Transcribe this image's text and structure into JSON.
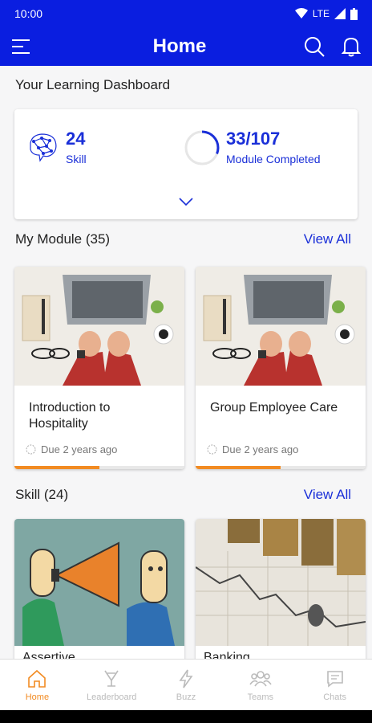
{
  "status": {
    "time": "10:00",
    "network": "LTE"
  },
  "header": {
    "title": "Home"
  },
  "dashboard": {
    "heading": "Your Learning Dashboard",
    "skills_count": "24",
    "skills_label": "Skill",
    "modules_count": "33/107",
    "modules_label": "Module Completed",
    "modules_progress": 0.31
  },
  "modules": {
    "heading": "My Module (35)",
    "view_all": "View All",
    "items": [
      {
        "title": "Introduction to Hospitality",
        "due": "Due 2 years ago",
        "progress": 0.5
      },
      {
        "title": "Group Employee Care",
        "due": "Due 2 years ago",
        "progress": 0.5
      }
    ]
  },
  "skills": {
    "heading": "Skill (24)",
    "view_all": "View All",
    "items": [
      {
        "title": "Assertive"
      },
      {
        "title": "Banking"
      }
    ]
  },
  "nav": {
    "items": [
      {
        "label": "Home",
        "icon": "home-icon",
        "active": true
      },
      {
        "label": "Leaderboard",
        "icon": "leaderboard-icon",
        "active": false
      },
      {
        "label": "Buzz",
        "icon": "lightning-icon",
        "active": false
      },
      {
        "label": "Teams",
        "icon": "teams-icon",
        "active": false
      },
      {
        "label": "Chats",
        "icon": "chat-icon",
        "active": false
      }
    ]
  },
  "colors": {
    "primary": "#0a1ee0",
    "accent": "#f28b22",
    "link": "#1a2fd8"
  }
}
